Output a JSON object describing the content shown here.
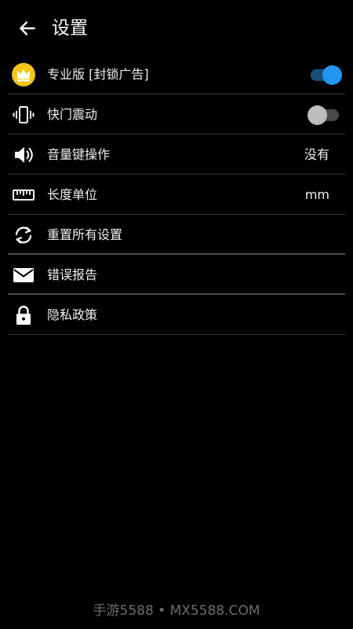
{
  "header": {
    "title": "设置"
  },
  "settings": [
    {
      "label": "专业版 [封锁广告]",
      "control": "toggle",
      "state": "on",
      "icon": "crown-icon"
    },
    {
      "label": "快门震动",
      "control": "toggle",
      "state": "off",
      "icon": "vibration-icon"
    },
    {
      "label": "音量键操作",
      "control": "value",
      "value": "没有",
      "icon": "volume-icon"
    },
    {
      "label": "长度单位",
      "control": "value",
      "value": "mm",
      "icon": "ruler-icon"
    },
    {
      "label": "重置所有设置",
      "control": "none",
      "icon": "reset-icon"
    },
    {
      "label": "错误报告",
      "control": "none",
      "icon": "mail-icon"
    },
    {
      "label": "隐私政策",
      "control": "none",
      "icon": "lock-icon"
    }
  ],
  "watermark": "手游5588 • MX5588.COM",
  "colors": {
    "accent": "#2196f3",
    "crown_bg": "#f5c518",
    "background": "#000000"
  }
}
